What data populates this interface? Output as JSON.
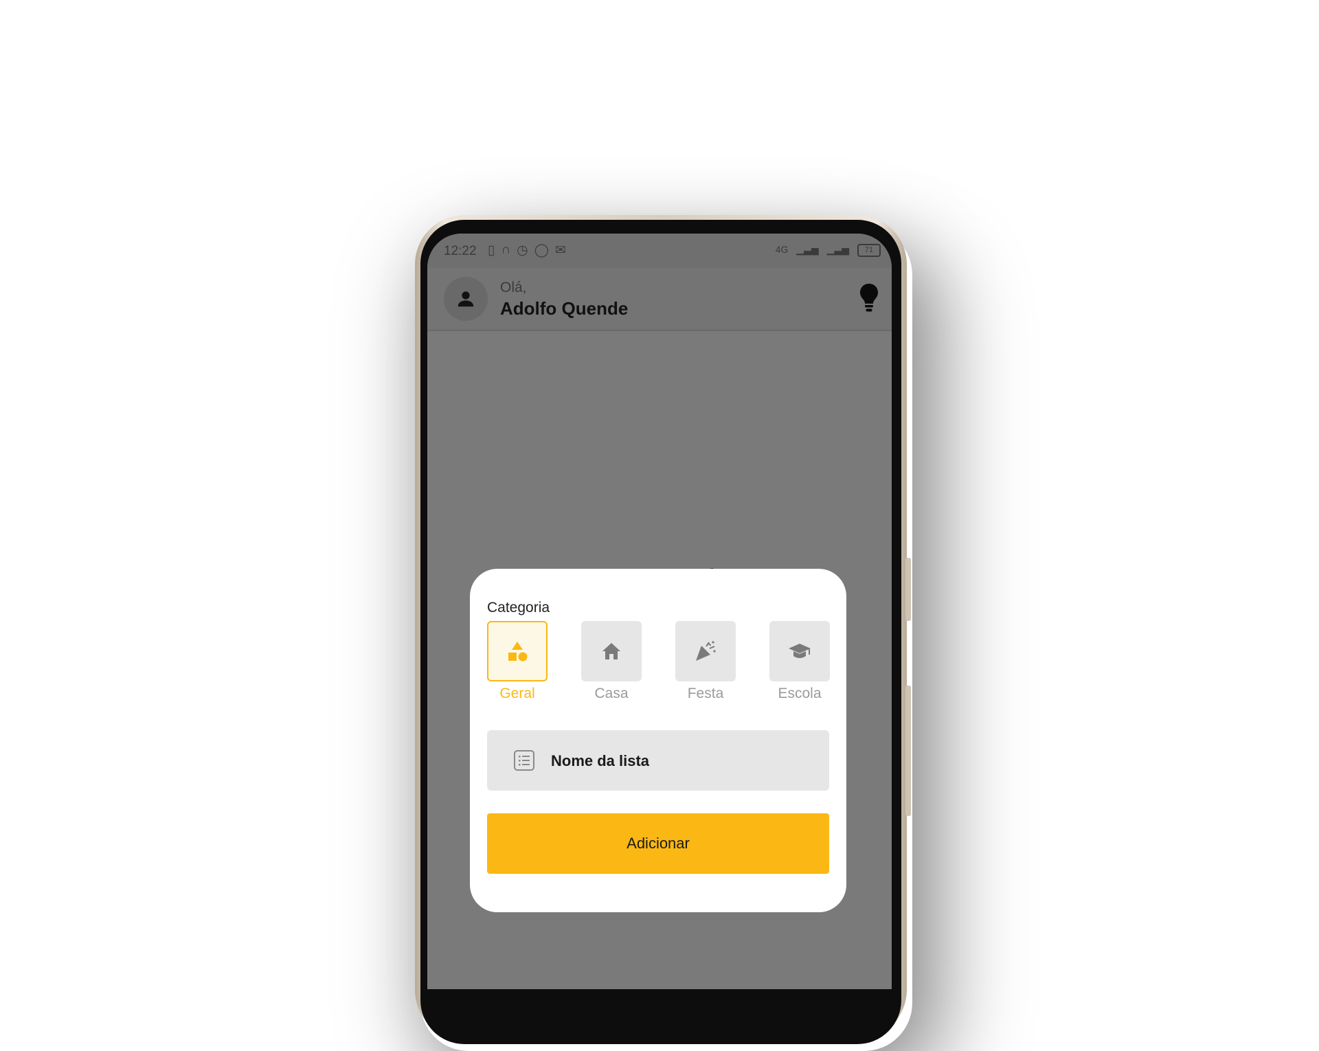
{
  "colors": {
    "accent": "#fbb814",
    "tile_bg": "#e6e6e6",
    "scrim": "#7a7a7a"
  },
  "statusbar": {
    "time": "12:22",
    "network": "4G",
    "battery": "71",
    "icons": [
      "vibrate-icon",
      "headset-icon",
      "alarm-icon",
      "whatsapp-icon",
      "mail-off-icon",
      "signal-icon",
      "signal-icon",
      "battery-icon"
    ]
  },
  "header": {
    "greeting": "Olá,",
    "user_name": "Adolfo Quende",
    "avatar_icon": "person-icon",
    "action_icon": "lightbulb-icon"
  },
  "modal": {
    "category_title": "Categoria",
    "categories": [
      {
        "label": "Geral",
        "icon": "shapes-icon",
        "selected": true
      },
      {
        "label": "Casa",
        "icon": "home-icon",
        "selected": false
      },
      {
        "label": "Festa",
        "icon": "party-popper-icon",
        "selected": false
      },
      {
        "label": "Escola",
        "icon": "graduation-cap-icon",
        "selected": false
      }
    ],
    "name_field": {
      "placeholder": "Nome da lista",
      "icon": "list-icon"
    },
    "submit_label": "Adicionar"
  }
}
